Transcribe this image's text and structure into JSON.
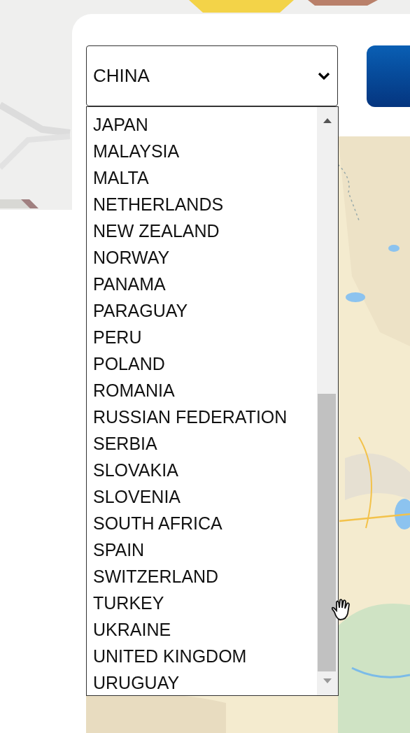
{
  "country_select": {
    "value": "CHINA"
  },
  "dropdown": {
    "options": [
      "JAPAN",
      "MALAYSIA",
      "MALTA",
      "NETHERLANDS",
      "NEW ZEALAND",
      "NORWAY",
      "PANAMA",
      "PARAGUAY",
      "PERU",
      "POLAND",
      "ROMANIA",
      "RUSSIAN FEDERATION",
      "SERBIA",
      "SLOVAKIA",
      "SLOVENIA",
      "SOUTH AFRICA",
      "SPAIN",
      "SWITZERLAND",
      "TURKEY",
      "UKRAINE",
      "UNITED KINGDOM",
      "URUGUAY"
    ]
  }
}
